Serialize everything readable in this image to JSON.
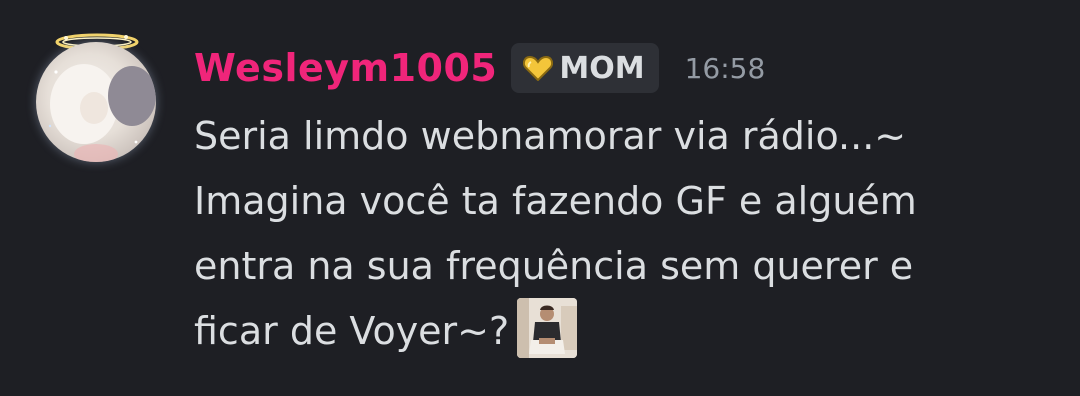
{
  "message": {
    "author": {
      "username": "Wesleym1005",
      "color": "#f0257a",
      "avatar_icon": "avatar-image"
    },
    "tag": {
      "icon": "yellow-heart-icon",
      "label": "MOM"
    },
    "timestamp": "16:58",
    "lines": [
      "Seria limdo webnamorar via rádio...~",
      "Imagina você ta fazendo GF e alguém",
      "entra na sua frequência sem querer e",
      "ficar de Voyer~?"
    ],
    "emoji": "custom-emoji-person-sitting"
  },
  "colors": {
    "background": "#1e1f24",
    "text": "#dbdee1",
    "muted": "#949ba4",
    "tag_bg": "#2e3036"
  }
}
